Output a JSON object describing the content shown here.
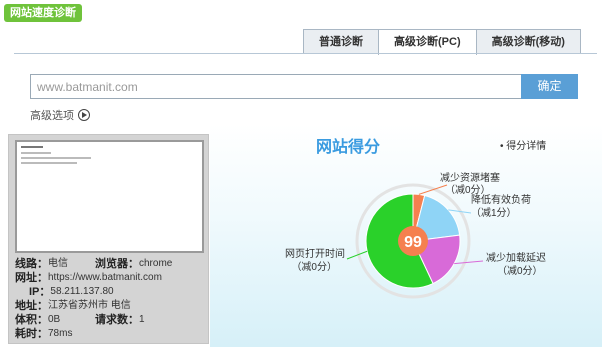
{
  "badge_label": "网站速度诊断",
  "tabs": [
    {
      "label": "普通诊断",
      "active": false
    },
    {
      "label": "高级诊断(PC)",
      "active": true
    },
    {
      "label": "高级诊断(移动)",
      "active": false
    }
  ],
  "search": {
    "placeholder": "www.batmanit.com",
    "value": "",
    "confirm_label": "确定"
  },
  "advanced_label": "高级选项",
  "info": {
    "route_label": "线路：",
    "route_value": "电信",
    "browser_label": "浏览器：",
    "browser_value": "chrome",
    "url_label": "网址：",
    "url_value": "https://www.batmanit.com",
    "ip_label": "IP：",
    "ip_value": "58.211.137.80",
    "addr_label": "地址：",
    "addr_value": "江苏省苏州市 电信",
    "size_label": "体积：",
    "size_value": "0B",
    "req_label": "请求数：",
    "req_value": "1",
    "time_label": "耗时：",
    "time_value": "78ms"
  },
  "score_title": "网站得分",
  "detail_link": "得分详情",
  "colors": {
    "accent": "#5a9fd6",
    "green": "#2ad12a",
    "orange": "#f5804f",
    "blue": "#8fd4f6",
    "purple": "#d86ad8"
  },
  "chart_data": {
    "type": "pie",
    "score": "99",
    "slices": [
      {
        "name": "减少资源堵塞",
        "deduct": "（减0分）",
        "value": 4,
        "color": "#f5804f"
      },
      {
        "name": "降低有效负荷",
        "deduct": "（减1分）",
        "value": 19,
        "color": "#8fd4f6"
      },
      {
        "name": "减少加载延迟",
        "deduct": "（减0分）",
        "value": 20,
        "color": "#d86ad8"
      },
      {
        "name": "网页打开时间",
        "deduct": "（减0分）",
        "value": 57,
        "color": "#2ad12a"
      }
    ]
  }
}
